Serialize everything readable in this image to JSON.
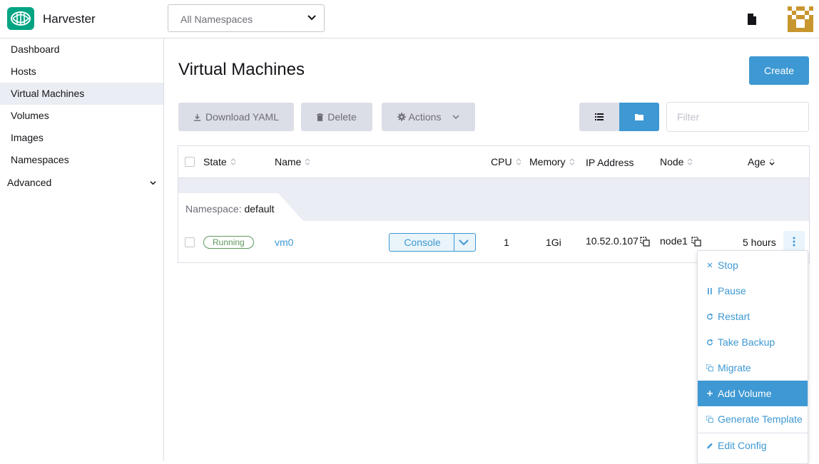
{
  "header": {
    "app_title": "Harvester",
    "namespace_select": {
      "value": "All Namespaces"
    }
  },
  "sidebar": {
    "items": [
      {
        "label": "Dashboard"
      },
      {
        "label": "Hosts"
      },
      {
        "label": "Virtual Machines",
        "active": true
      },
      {
        "label": "Volumes"
      },
      {
        "label": "Images"
      },
      {
        "label": "Namespaces"
      }
    ],
    "advanced_label": "Advanced"
  },
  "main": {
    "title": "Virtual Machines",
    "create_label": "Create",
    "toolbar": {
      "download_label": "Download YAML",
      "delete_label": "Delete",
      "actions_label": "Actions"
    },
    "filter_placeholder": "Filter"
  },
  "table": {
    "columns": [
      "State",
      "Name",
      "CPU",
      "Memory",
      "IP Address",
      "Node",
      "Age"
    ],
    "group": {
      "prefix": "Namespace:",
      "name": "default"
    },
    "rows": [
      {
        "state": "Running",
        "name": "vm0",
        "console_label": "Console",
        "cpu": "1",
        "memory": "1Gi",
        "ip": "10.52.0.107",
        "node": "node1",
        "age": "5 hours"
      }
    ]
  },
  "menu": {
    "items": [
      {
        "label": "Stop",
        "icon": "close-icon"
      },
      {
        "label": "Pause",
        "icon": "pause-icon"
      },
      {
        "label": "Restart",
        "icon": "refresh-icon"
      },
      {
        "label": "Take Backup",
        "icon": "refresh-icon"
      },
      {
        "label": "Migrate",
        "icon": "copy-icon"
      },
      {
        "label": "Add Volume",
        "icon": "plus-icon",
        "highlighted": true
      },
      {
        "label": "Generate Template",
        "icon": "copy-icon"
      },
      {
        "label": "Edit Config",
        "icon": "pencil-icon"
      }
    ]
  },
  "colors": {
    "accent": "#3d98d3",
    "brand": "#00a483",
    "success": "#5d995d",
    "muted_bg": "#dcdee7"
  }
}
